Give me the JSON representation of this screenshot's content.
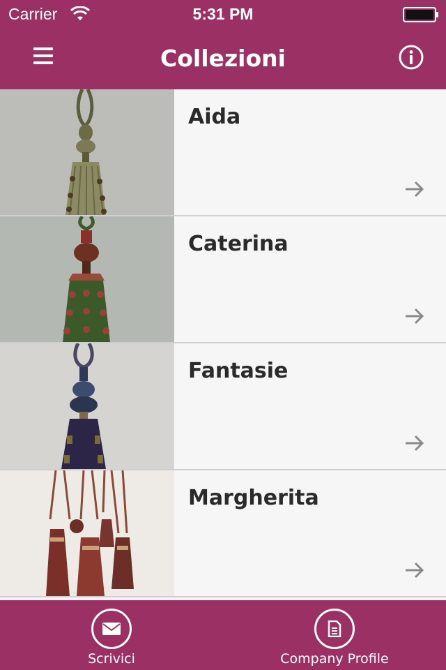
{
  "status_bar": {
    "carrier": "Carrier",
    "time": "5:31 PM"
  },
  "nav": {
    "title": "Collezioni"
  },
  "collections": [
    {
      "title": "Aida"
    },
    {
      "title": "Caterina"
    },
    {
      "title": "Fantasie"
    },
    {
      "title": "Margherita"
    }
  ],
  "tabs": [
    {
      "label": "Scrivici",
      "icon": "envelope-icon"
    },
    {
      "label": "Company Profile",
      "icon": "document-icon"
    }
  ],
  "colors": {
    "brand": "#9a3064",
    "list_bg": "#f6f6f6",
    "arrow": "#8a8a8a"
  }
}
